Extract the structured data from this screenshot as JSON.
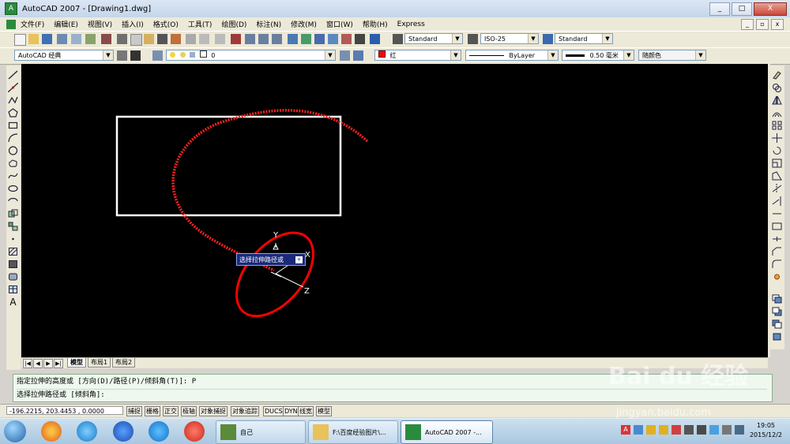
{
  "window": {
    "title": "AutoCAD 2007 - [Drawing1.dwg]",
    "buttons": [
      "_",
      "□",
      "X"
    ],
    "mdi_buttons": [
      "_",
      "▫",
      "x"
    ]
  },
  "menu": [
    "文件(F)",
    "编辑(E)",
    "视图(V)",
    "插入(I)",
    "格式(O)",
    "工具(T)",
    "绘图(D)",
    "标注(N)",
    "修改(M)",
    "窗口(W)",
    "帮助(H)",
    "Express"
  ],
  "toolbar": {
    "text_style": "Standard",
    "dim_style": "ISO-25",
    "table_style": "Standard",
    "workspace": "AutoCAD 经典",
    "layer": "0",
    "color": "红",
    "linetype": "ByLayer",
    "lineweight": "0.50 毫米",
    "plotstyle": "随颜色"
  },
  "canvas": {
    "ucs_y": "Y",
    "ucs_z": "Z",
    "ucs_x": "X",
    "tooltip": "选择拉伸路径或",
    "tooltip_btn": "+"
  },
  "tabs": [
    "模型",
    "布局1",
    "布局2"
  ],
  "tab_nav": [
    "|◀",
    "◀",
    "▶",
    "▶|"
  ],
  "command": {
    "line1": "指定拉伸的高度或 [方向(D)/路径(P)/倾斜角(T)]: P",
    "line2": "选择拉伸路径或 [倾斜角]:"
  },
  "status": {
    "coords": "-196.2215, 203.4453 , 0.0000",
    "buttons": [
      "捕捉",
      "栅格",
      "正交",
      "极轴",
      "对象捕捉",
      "对象追踪",
      "DUCS",
      "DYN",
      "线宽",
      "模型"
    ]
  },
  "taskbar": {
    "tasks": [
      "自己",
      "F:\\百度经验图片\\...",
      "AutoCAD 2007 -..."
    ],
    "time": "19:05",
    "date": "2015/12/2",
    "tray_lang": "A"
  },
  "watermark": {
    "text": "Bai du 经验",
    "url": "jingyan.baidu.com"
  },
  "colors": {
    "canvas": "#000000",
    "path": "#ff0000",
    "rectangle": "#ffffff",
    "tooltip": "#1a2a78"
  }
}
